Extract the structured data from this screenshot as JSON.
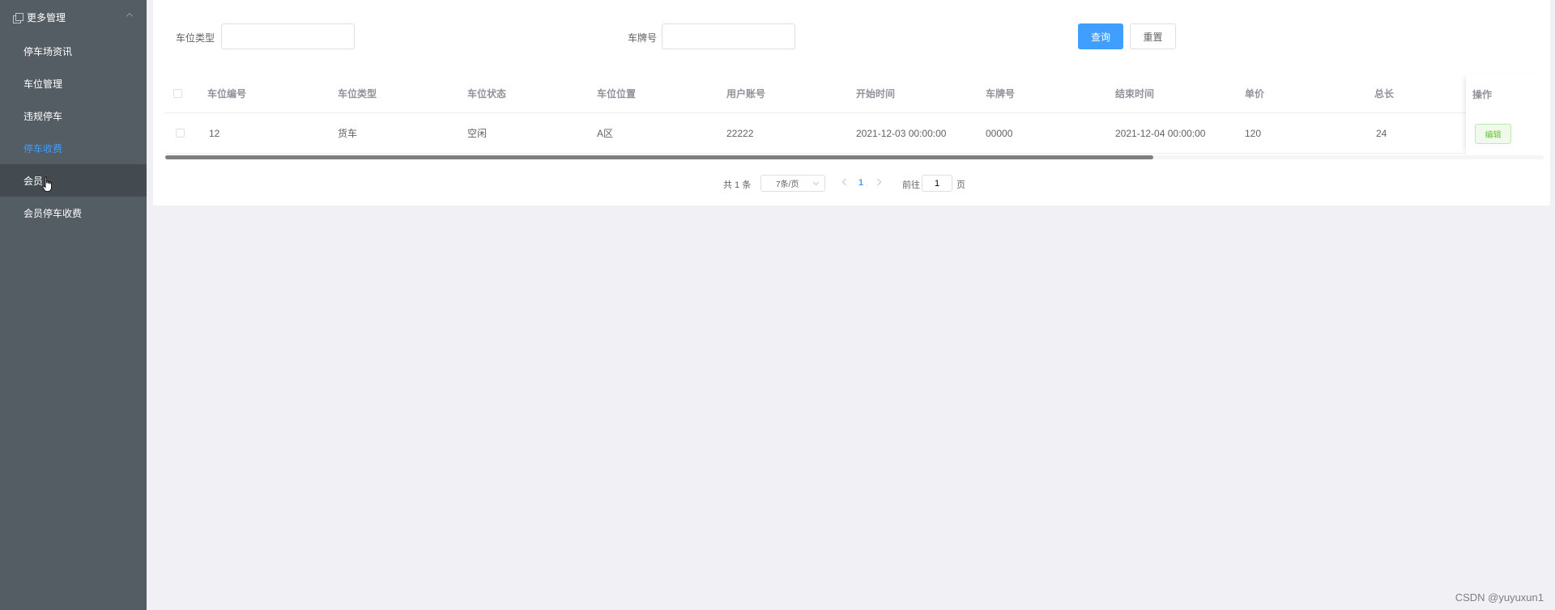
{
  "sidebar": {
    "group_title": "更多管理",
    "items": [
      {
        "label": "停车场资讯",
        "active": false
      },
      {
        "label": "车位管理",
        "active": false
      },
      {
        "label": "违规停车",
        "active": false
      },
      {
        "label": "停车收费",
        "active": true
      },
      {
        "label": "会员",
        "active": false,
        "hover": true
      },
      {
        "label": "会员停车收费",
        "active": false
      }
    ]
  },
  "search": {
    "type_label": "车位类型",
    "type_value": "",
    "plate_label": "车牌号",
    "plate_value": "",
    "query_button": "查询",
    "reset_button": "重置"
  },
  "table": {
    "columns": [
      "车位编号",
      "车位类型",
      "车位状态",
      "车位位置",
      "用户账号",
      "开始时间",
      "车牌号",
      "结束时间",
      "单价",
      "总长",
      "操作"
    ],
    "rows": [
      {
        "cells": [
          "12",
          "货车",
          "空闲",
          "A区",
          "22222",
          "2021-12-03 00:00:00",
          "00000",
          "2021-12-04 00:00:00",
          "120",
          "24"
        ],
        "action": "编辑"
      }
    ]
  },
  "pagination": {
    "total_text": "共 1 条",
    "page_size": "7条/页",
    "current_page": "1",
    "goto_label": "前往",
    "goto_value": "1",
    "goto_suffix": "页"
  },
  "watermark": "CSDN @yuyuxun1",
  "colors": {
    "sidebar_bg": "#545c64",
    "active_text": "#409eff",
    "primary": "#409eff",
    "success_text": "#67c23a"
  }
}
